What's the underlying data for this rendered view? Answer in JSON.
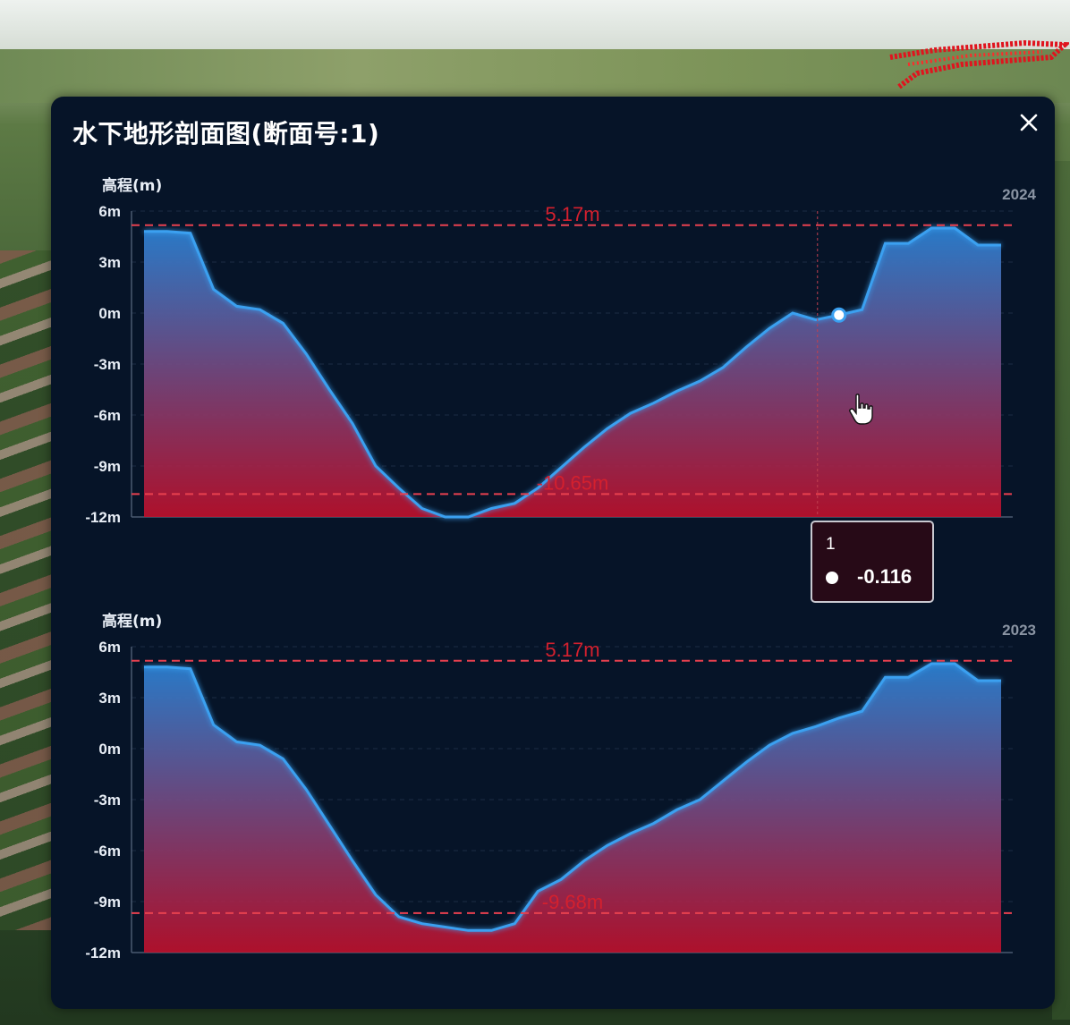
{
  "dialog": {
    "title": "水下地形剖面图(断面号:1)",
    "close_icon": "close-icon"
  },
  "charts": [
    {
      "year": "2024",
      "y_title": "高程(m)",
      "max_label": "5.17m",
      "min_label": "-10.65m",
      "tooltip": {
        "x": "1",
        "value": "-0.116",
        "index": 30
      }
    },
    {
      "year": "2023",
      "y_title": "高程(m)",
      "max_label": "5.17m",
      "min_label": "-9.68m"
    }
  ],
  "colors": {
    "panel_bg": "#061428",
    "line": "#3aa0f0",
    "area_top": "#2a7fd0",
    "area_bottom": "#c0102c",
    "markline": "#e8404f",
    "markline_label": "#d4202e"
  },
  "chart_data": [
    {
      "type": "area",
      "title": "2024",
      "ylabel": "高程(m)",
      "ylim": [
        -12,
        6
      ],
      "y_ticks": [
        "6m",
        "3m",
        "0m",
        "-3m",
        "-6m",
        "-9m",
        "-12m"
      ],
      "grid": true,
      "legend": "none",
      "series": [
        {
          "values": [
            4.8,
            4.8,
            4.7,
            1.4,
            0.4,
            0.2,
            -0.6,
            -2.4,
            -4.5,
            -6.5,
            -9.0,
            -10.3,
            -11.5,
            -12.0,
            -12.0,
            -11.5,
            -11.2,
            -10.3,
            -9.1,
            -7.9,
            -6.8,
            -5.9,
            -5.3,
            -4.6,
            -4.0,
            -3.2,
            -2.0,
            -0.9,
            0.0,
            -0.4,
            -0.116,
            0.2,
            4.1,
            4.1,
            5.0,
            5.0,
            4.0,
            4.0
          ]
        }
      ],
      "mark_lines": [
        {
          "label": "5.17m",
          "y": 5.17
        },
        {
          "label": "-10.65m",
          "y": -10.65
        }
      ]
    },
    {
      "type": "area",
      "title": "2023",
      "ylabel": "高程(m)",
      "ylim": [
        -12,
        6
      ],
      "y_ticks": [
        "6m",
        "3m",
        "0m",
        "-3m",
        "-6m",
        "-9m",
        "-12m"
      ],
      "grid": true,
      "legend": "none",
      "series": [
        {
          "values": [
            4.8,
            4.8,
            4.7,
            1.4,
            0.4,
            0.2,
            -0.6,
            -2.4,
            -4.5,
            -6.6,
            -8.6,
            -9.9,
            -10.3,
            -10.5,
            -10.7,
            -10.7,
            -10.3,
            -8.4,
            -7.7,
            -6.6,
            -5.7,
            -5.0,
            -4.4,
            -3.6,
            -3.0,
            -1.9,
            -0.8,
            0.2,
            0.9,
            1.3,
            1.8,
            2.2,
            4.2,
            4.2,
            5.0,
            5.0,
            4.0,
            4.0
          ]
        }
      ],
      "mark_lines": [
        {
          "label": "5.17m",
          "y": 5.17
        },
        {
          "label": "-9.68m",
          "y": -9.68
        }
      ]
    }
  ]
}
